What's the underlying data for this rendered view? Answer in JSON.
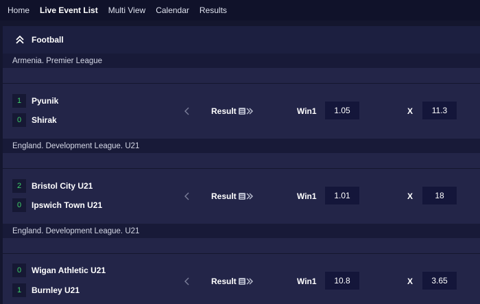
{
  "nav": {
    "items": [
      {
        "label": "Home"
      },
      {
        "label": "Live Event List"
      },
      {
        "label": "Multi View"
      },
      {
        "label": "Calendar"
      },
      {
        "label": "Results"
      }
    ],
    "active_index": 1
  },
  "sport": {
    "name": "Football",
    "icon": "double-chevron-up-icon"
  },
  "leagues": [
    {
      "name": "Armenia. Premier League"
    },
    {
      "name": "England. Development League. U21"
    },
    {
      "name": "England. Development League. U21"
    }
  ],
  "events": [
    {
      "team1": {
        "score": "1",
        "name": "Pyunik"
      },
      "team2": {
        "score": "0",
        "name": "Shirak"
      },
      "market": "Result",
      "win1_label": "Win1",
      "win1_odd": "1.05",
      "x_label": "X",
      "x_odd": "11.3"
    },
    {
      "team1": {
        "score": "2",
        "name": "Bristol City U21"
      },
      "team2": {
        "score": "0",
        "name": "Ipswich Town U21"
      },
      "market": "Result",
      "win1_label": "Win1",
      "win1_odd": "1.01",
      "x_label": "X",
      "x_odd": "18"
    },
    {
      "team1": {
        "score": "0",
        "name": "Wigan Athletic U21"
      },
      "team2": {
        "score": "1",
        "name": "Burnley U21"
      },
      "market": "Result",
      "win1_label": "Win1",
      "win1_odd": "10.8",
      "x_label": "X",
      "x_odd": "3.65"
    }
  ],
  "colors": {
    "score_green": "#3fd46a",
    "background": "#14162e",
    "row_background": "#232548"
  }
}
